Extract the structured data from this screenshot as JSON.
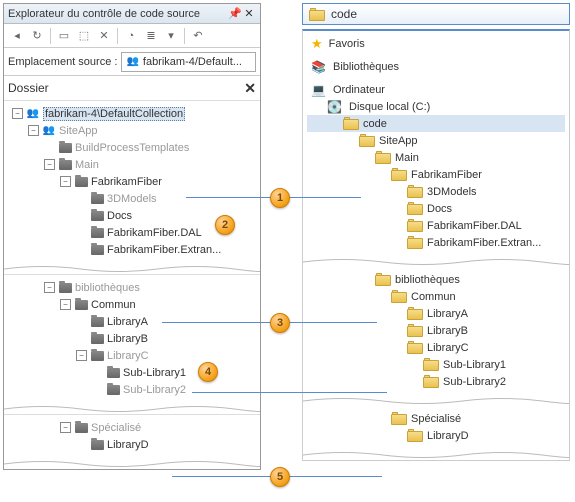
{
  "left": {
    "window_title": "Explorateur du contrôle de code source",
    "toolbar_icons": [
      "back-icon",
      "refresh-icon",
      "open-icon",
      "add-icon",
      "delete-icon",
      "clock-icon",
      "compare-icon",
      "filter-icon",
      "undo-icon"
    ],
    "location_label": "Emplacement source :",
    "location_value": "fabrikam-4/Default...",
    "folder_header": "Dossier",
    "sections": [
      {
        "id": "sec1",
        "rows": [
          {
            "depth": 0,
            "exp": "-",
            "icon": "ws",
            "label": "fabrikam-4\\DefaultCollection",
            "sel": true
          },
          {
            "depth": 1,
            "exp": "-",
            "icon": "ws",
            "label": "SiteApp",
            "dim": true
          },
          {
            "depth": 2,
            "exp": " ",
            "icon": "tf",
            "label": "BuildProcessTemplates",
            "dim": true
          },
          {
            "depth": 2,
            "exp": "-",
            "icon": "tf",
            "label": "Main",
            "dim": true
          },
          {
            "depth": 3,
            "exp": "-",
            "icon": "tf",
            "label": "FabrikamFiber",
            "link": 1
          },
          {
            "depth": 4,
            "exp": " ",
            "icon": "tf",
            "label": "3DModels",
            "dim": true
          },
          {
            "depth": 4,
            "exp": " ",
            "icon": "tf",
            "label": "Docs",
            "badge": 2
          },
          {
            "depth": 4,
            "exp": " ",
            "icon": "tf",
            "label": "FabrikamFiber.DAL"
          },
          {
            "depth": 4,
            "exp": " ",
            "icon": "tf",
            "label": "FabrikamFiber.Extran..."
          }
        ]
      },
      {
        "id": "sec2",
        "rows": [
          {
            "depth": 2,
            "exp": "-",
            "icon": "tf",
            "label": "bibliothèques",
            "dim": true
          },
          {
            "depth": 3,
            "exp": "-",
            "icon": "tf",
            "label": "Commun",
            "link": 3
          },
          {
            "depth": 4,
            "exp": " ",
            "icon": "tf",
            "label": "LibraryA"
          },
          {
            "depth": 4,
            "exp": " ",
            "icon": "tf",
            "label": "LibraryB"
          },
          {
            "depth": 4,
            "exp": "-",
            "icon": "tf",
            "label": "LibraryC",
            "dim": true,
            "badge": 4
          },
          {
            "depth": 5,
            "exp": " ",
            "icon": "tf",
            "label": "Sub-Library1",
            "link": true
          },
          {
            "depth": 5,
            "exp": " ",
            "icon": "tf",
            "label": "Sub-Library2",
            "dim": true
          }
        ]
      },
      {
        "id": "sec3",
        "rows": [
          {
            "depth": 3,
            "exp": "-",
            "icon": "tf",
            "label": "Spécialisé",
            "dim": true
          },
          {
            "depth": 4,
            "exp": " ",
            "icon": "tf",
            "label": "LibraryD",
            "link": 5
          }
        ]
      }
    ]
  },
  "right": {
    "title": "code",
    "sections": [
      {
        "rows": [
          {
            "depth": 0,
            "icon": "star",
            "label": "Favoris"
          },
          {
            "depth": 0,
            "icon": "lib",
            "label": "Bibliothèques"
          },
          {
            "depth": 0,
            "icon": "pc",
            "label": "Ordinateur"
          },
          {
            "depth": 1,
            "icon": "disk",
            "label": "Disque local (C:)"
          },
          {
            "depth": 2,
            "icon": "yf",
            "label": "code",
            "sel": true
          },
          {
            "depth": 3,
            "icon": "yf",
            "label": "SiteApp"
          },
          {
            "depth": 4,
            "icon": "yf",
            "label": "Main"
          },
          {
            "depth": 5,
            "icon": "yf",
            "label": "FabrikamFiber"
          },
          {
            "depth": 6,
            "icon": "yf",
            "label": "3DModels"
          },
          {
            "depth": 6,
            "icon": "yf",
            "label": "Docs"
          },
          {
            "depth": 6,
            "icon": "yf",
            "label": "FabrikamFiber.DAL"
          },
          {
            "depth": 6,
            "icon": "yf",
            "label": "FabrikamFiber.Extran..."
          }
        ]
      },
      {
        "rows": [
          {
            "depth": 4,
            "icon": "yf",
            "label": "bibliothèques"
          },
          {
            "depth": 5,
            "icon": "yf",
            "label": "Commun"
          },
          {
            "depth": 6,
            "icon": "yf",
            "label": "LibraryA"
          },
          {
            "depth": 6,
            "icon": "yf",
            "label": "LibraryB"
          },
          {
            "depth": 6,
            "icon": "yf",
            "label": "LibraryC"
          },
          {
            "depth": 7,
            "icon": "yf",
            "label": "Sub-Library1"
          },
          {
            "depth": 7,
            "icon": "yf",
            "label": "Sub-Library2"
          }
        ]
      },
      {
        "rows": [
          {
            "depth": 5,
            "icon": "yf",
            "label": "Spécialisé"
          },
          {
            "depth": 6,
            "icon": "yf",
            "label": "LibraryD"
          }
        ]
      }
    ]
  },
  "badges": {
    "1": "1",
    "2": "2",
    "3": "3",
    "4": "4",
    "5": "5"
  }
}
